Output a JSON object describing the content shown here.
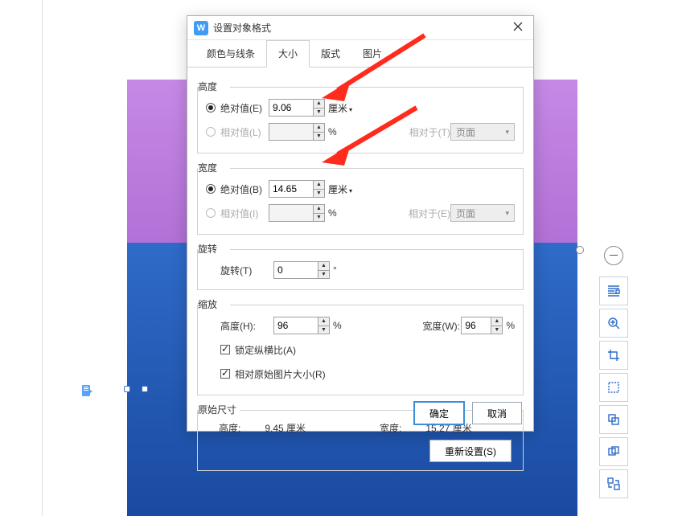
{
  "dialog": {
    "title": "设置对象格式",
    "tabs": {
      "color": "颜色与线条",
      "size": "大小",
      "layout": "版式",
      "picture": "图片"
    },
    "height": {
      "legend": "高度",
      "abs_label": "绝对值(E)",
      "abs_value": "9.06",
      "abs_unit": "厘米",
      "rel_label": "相对值(L)",
      "rel_value": "",
      "rel_unit": "%",
      "rel_to_label": "相对于(T)",
      "rel_to_value": "页面"
    },
    "width": {
      "legend": "宽度",
      "abs_label": "绝对值(B)",
      "abs_value": "14.65",
      "abs_unit": "厘米",
      "rel_label": "相对值(I)",
      "rel_value": "",
      "rel_unit": "%",
      "rel_to_label": "相对于(E)",
      "rel_to_value": "页面"
    },
    "rotate": {
      "legend": "旋转",
      "label": "旋转(T)",
      "value": "0",
      "unit": "°"
    },
    "scale": {
      "legend": "缩放",
      "h_label": "高度(H):",
      "h_value": "96",
      "h_unit": "%",
      "w_label": "宽度(W):",
      "w_value": "96",
      "w_unit": "%",
      "lock_label": "锁定纵横比(A)",
      "orig_label": "相对原始图片大小(R)"
    },
    "original": {
      "legend": "原始尺寸",
      "h_label": "高度:",
      "h_value": "9.45 厘米",
      "w_label": "宽度:",
      "w_value": "15.27 厘米",
      "reset": "重新设置(S)"
    },
    "buttons": {
      "ok": "确定",
      "cancel": "取消"
    }
  }
}
